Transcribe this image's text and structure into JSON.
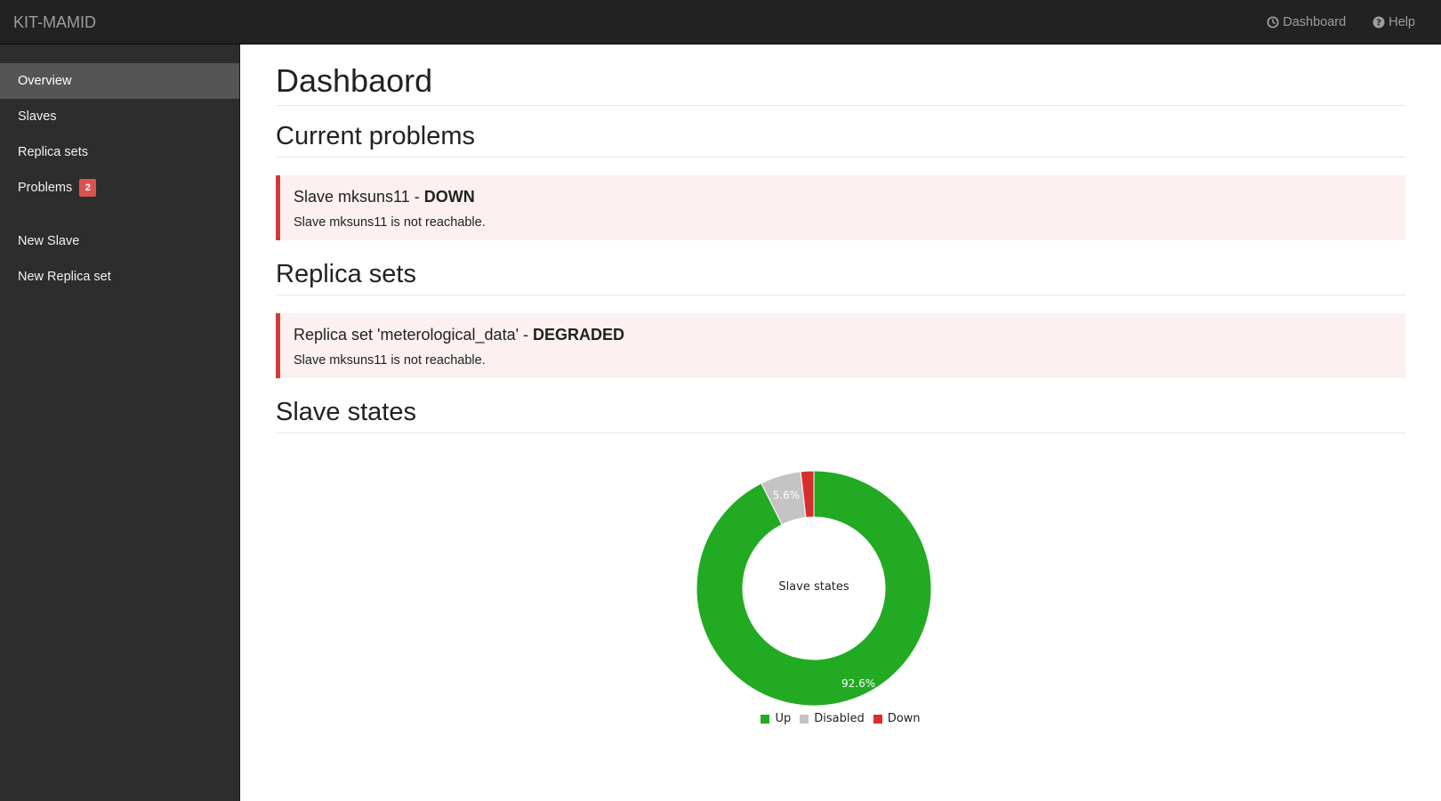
{
  "app": {
    "brand": "KIT-MAMID"
  },
  "topnav": {
    "dashboard": "Dashboard",
    "help": "Help"
  },
  "sidebar": {
    "items": [
      {
        "label": "Overview",
        "active": true
      },
      {
        "label": "Slaves"
      },
      {
        "label": "Replica sets"
      },
      {
        "label": "Problems",
        "badge": "2"
      },
      {
        "label": "New Slave"
      },
      {
        "label": "New Replica set"
      }
    ]
  },
  "main": {
    "title": "Dashbaord",
    "sections": {
      "problems": "Current problems",
      "replica_sets": "Replica sets",
      "slave_states": "Slave states"
    },
    "problem_alert": {
      "title_prefix": "Slave mksuns11 - ",
      "title_state": "DOWN",
      "body": "Slave mksuns11 is not reachable."
    },
    "replica_alert": {
      "title_prefix": "Replica set 'meterological_data' - ",
      "title_state": "DEGRADED",
      "body": "Slave mksuns11 is not reachable."
    }
  },
  "colors": {
    "up": "#22aa22",
    "disabled": "#c4c4c4",
    "down": "#d62f2f",
    "alert_border": "#d03a3a"
  },
  "chart_data": {
    "type": "pie",
    "title": "Slave states",
    "categories": [
      "Up",
      "Disabled",
      "Down"
    ],
    "values": [
      92.6,
      5.6,
      1.8
    ],
    "labels": [
      "92.6%",
      "5.6%",
      ""
    ],
    "legend": "bottom"
  }
}
